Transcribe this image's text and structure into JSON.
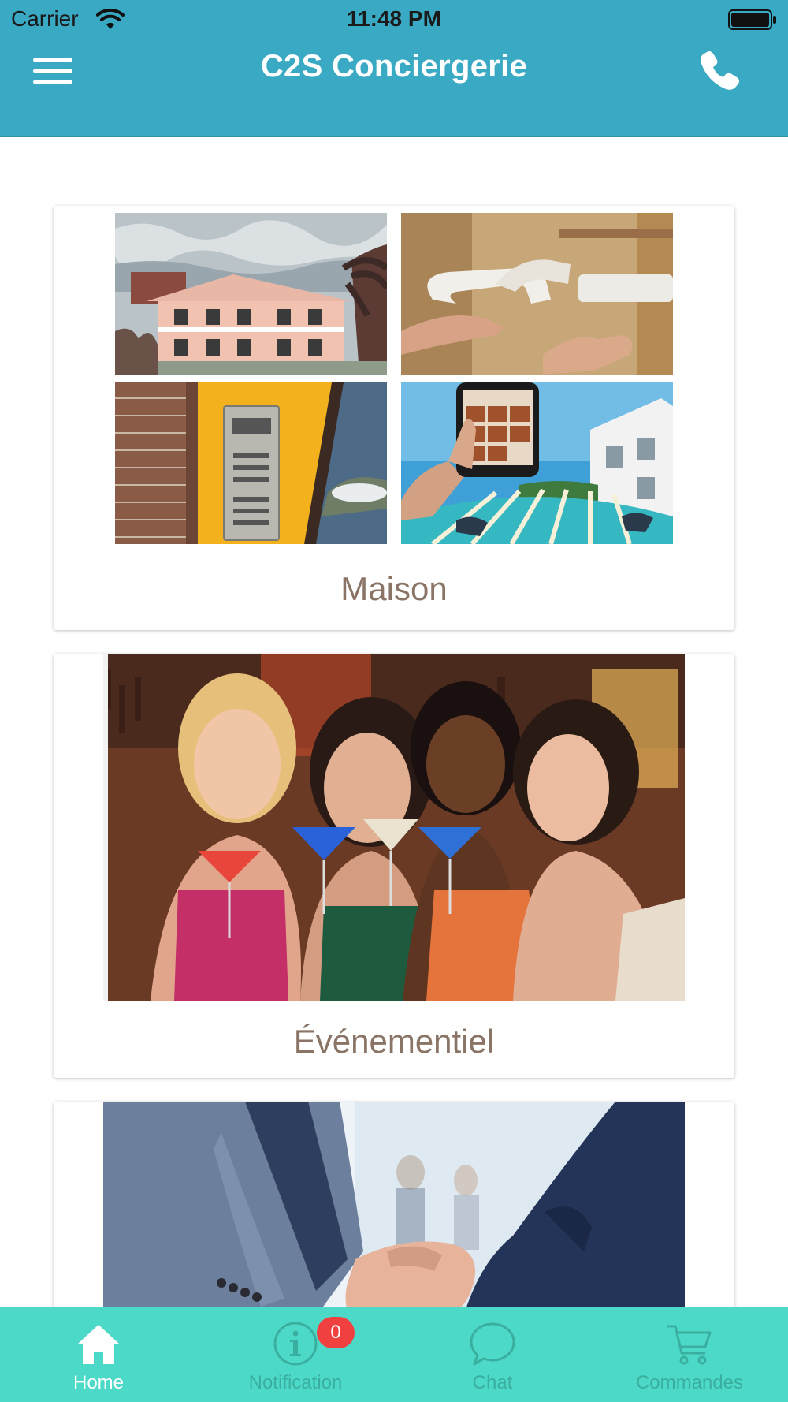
{
  "status_bar": {
    "carrier": "Carrier",
    "time": "11:48 PM"
  },
  "header": {
    "title": "C2S Conciergerie",
    "menu_icon": "hamburger-menu-icon",
    "call_icon": "phone-icon",
    "background_color": "#3aaac4"
  },
  "cards": [
    {
      "label": "Maison"
    },
    {
      "label": "Événementiel"
    },
    {
      "label": ""
    }
  ],
  "tabbar": {
    "background_color": "#4dd9c7",
    "tabs": [
      {
        "label": "Home",
        "icon": "home-icon",
        "active": true
      },
      {
        "label": "Notification",
        "icon": "info-icon",
        "badge": "0"
      },
      {
        "label": "Chat",
        "icon": "chat-bubble-icon"
      },
      {
        "label": "Commandes",
        "icon": "cart-icon"
      }
    ]
  }
}
